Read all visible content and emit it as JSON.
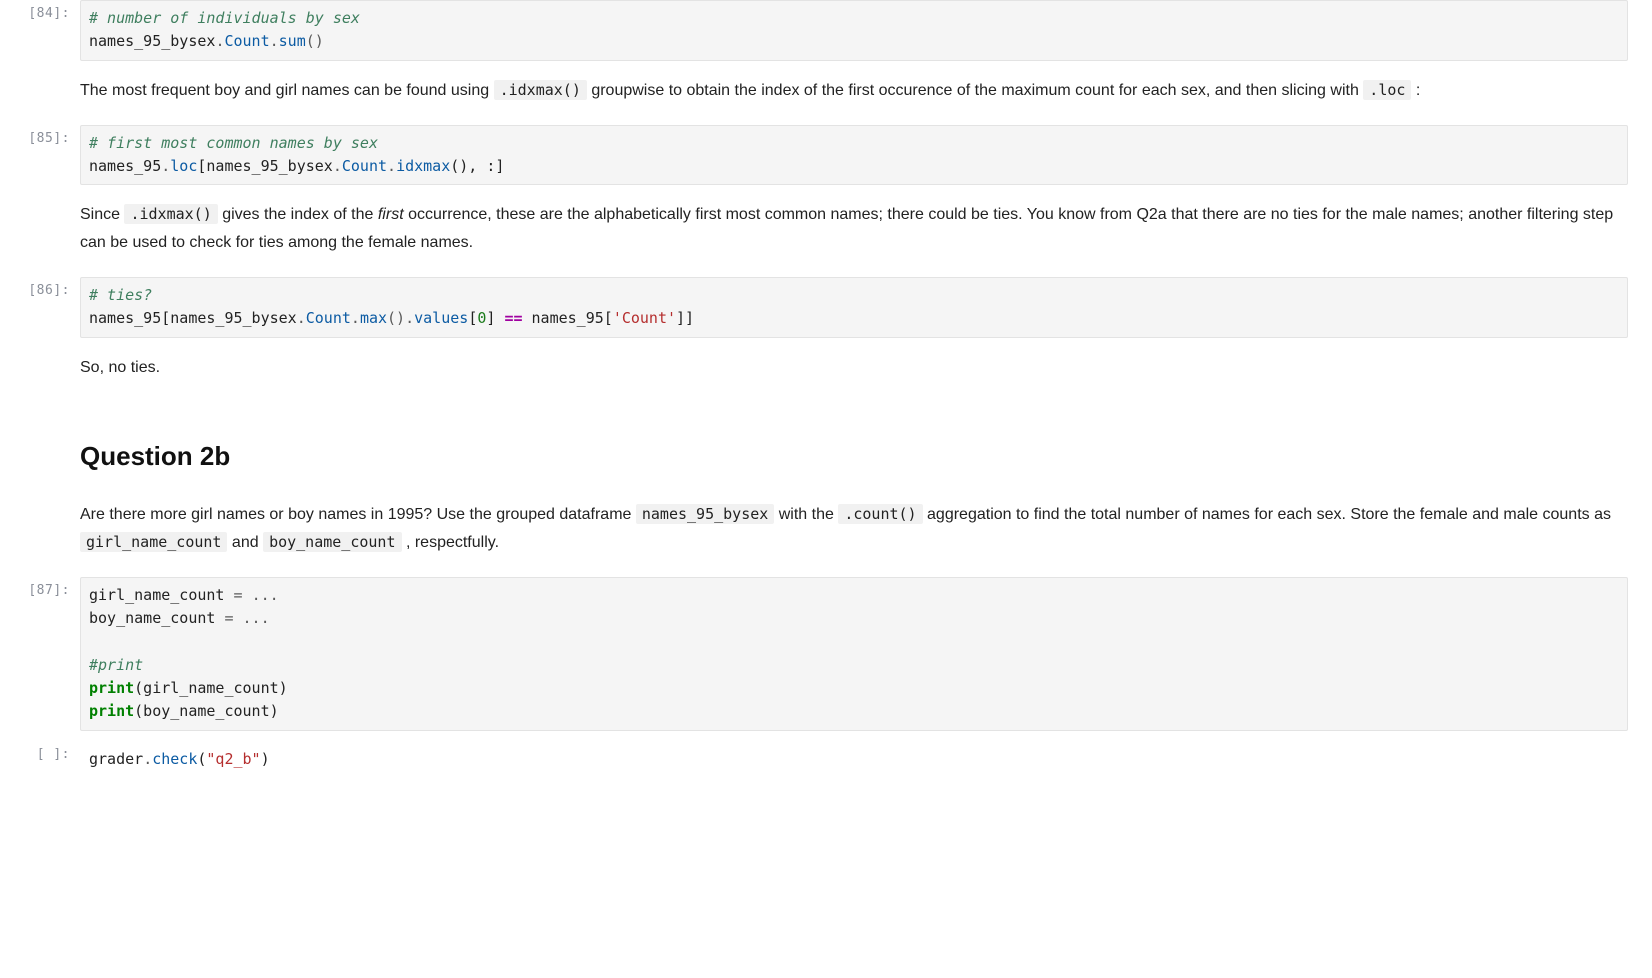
{
  "cells": {
    "c84": {
      "prompt": "[84]:",
      "code": {
        "l1_cm": "# number of individuals by sex",
        "l2_a": "names_95_bysex",
        "l2_b": ".",
        "l2_c": "Count",
        "l2_d": ".",
        "l2_e": "sum",
        "l2_f": "()"
      }
    },
    "md1": {
      "t1": "The most frequent boy and girl names can be found using ",
      "code1": ".idxmax()",
      "t2": " groupwise to obtain the index of the first occurence of the maximum count for each sex, and then slicing with ",
      "code2": ".loc",
      "t3": " :"
    },
    "c85": {
      "prompt": "[85]:",
      "code": {
        "l1_cm": "# first most common names by sex",
        "l2_a": "names_95",
        "l2_b": ".",
        "l2_c": "loc",
        "l2_d": "[names_95_bysex",
        "l2_e": ".",
        "l2_f": "Count",
        "l2_g": ".",
        "l2_h": "idxmax",
        "l2_i": "(), :]"
      }
    },
    "md2": {
      "t1": "Since ",
      "code1": ".idxmax()",
      "t2": " gives the index of the ",
      "em": "first",
      "t3": " occurrence, these are the alphabetically first most common names; there could be ties. You know from Q2a that there are no ties for the male names; another filtering step can be used to check for ties among the female names."
    },
    "c86": {
      "prompt": "[86]:",
      "code": {
        "l1_cm": "# ties?",
        "l2_a": "names_95[names_95_bysex",
        "l2_b": ".",
        "l2_c": "Count",
        "l2_d": ".",
        "l2_e": "max",
        "l2_f": "()",
        "l2_g": ".",
        "l2_h": "values",
        "l2_i": "[",
        "l2_j": "0",
        "l2_k": "] ",
        "l2_l": "==",
        "l2_m": " names_95[",
        "l2_n": "'Count'",
        "l2_o": "]]"
      }
    },
    "md3": {
      "t1": "So, no ties."
    },
    "md4": {
      "heading": "Question 2b",
      "t1": "Are there more girl names or boy names in 1995? Use the grouped dataframe ",
      "code1": "names_95_bysex",
      "t2": " with the ",
      "code2": ".count()",
      "t3": " aggregation to find the total number of names for each sex. Store the female and male counts as ",
      "code3": "girl_name_count",
      "t4": " and ",
      "code4": "boy_name_count",
      "t5": " , respectfully."
    },
    "c87": {
      "prompt": "[87]:",
      "code": {
        "l1_a": "girl_name_count ",
        "l1_b": "=",
        "l1_c": " ",
        "l1_d": "...",
        "l2_a": "boy_name_count ",
        "l2_b": "=",
        "l2_c": " ",
        "l2_d": "...",
        "l4_cm": "#print",
        "l5_a": "print",
        "l5_b": "(girl_name_count)",
        "l6_a": "print",
        "l6_b": "(boy_name_count)"
      }
    },
    "c_empty": {
      "prompt": "[ ]:",
      "code": {
        "l1_a": "grader",
        "l1_b": ".",
        "l1_c": "check",
        "l1_d": "(",
        "l1_e": "\"q2_b\"",
        "l1_f": ")"
      }
    }
  }
}
